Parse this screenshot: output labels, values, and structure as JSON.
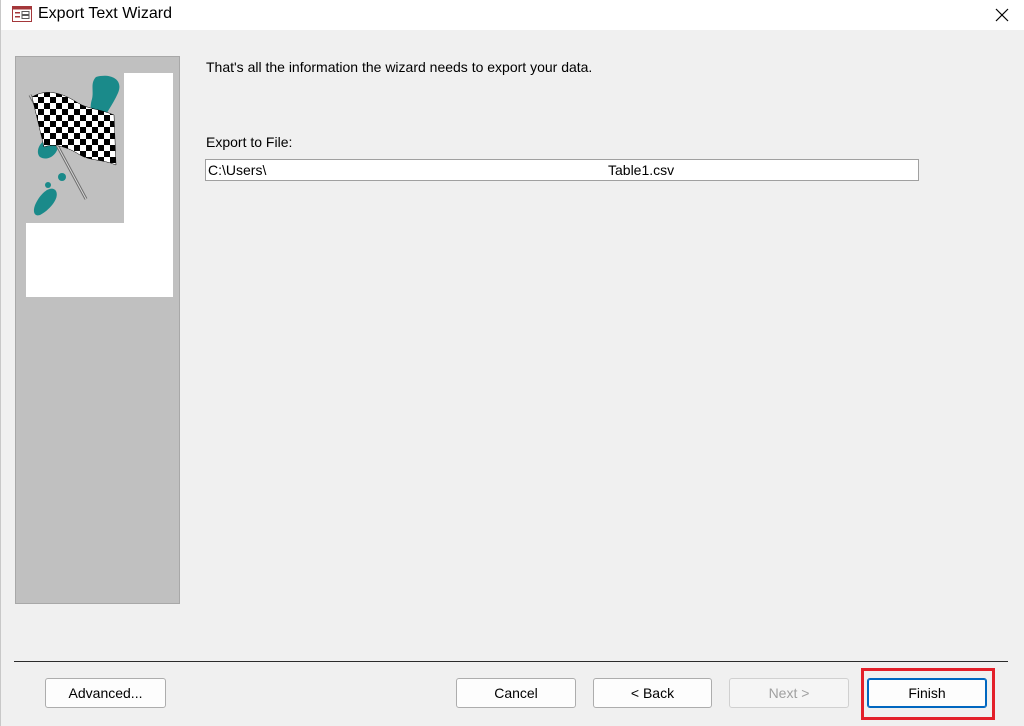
{
  "window": {
    "title": "Export Text Wizard"
  },
  "icons": {
    "title": "access-form-icon",
    "close": "close-icon",
    "graphic": "checkered-flag-icon"
  },
  "content": {
    "intro_text": "That's all the information the wizard needs to export your data.",
    "export_label": "Export to File:",
    "path_prefix": "C:\\Users\\",
    "path_suffix": "Table1.csv"
  },
  "buttons": {
    "advanced": "Advanced...",
    "cancel": "Cancel",
    "back": "< Back",
    "next": "Next >",
    "finish": "Finish"
  },
  "colors": {
    "highlight": "#e3202a",
    "accent": "#0067c0",
    "flag_teal": "#1a8a8a"
  }
}
